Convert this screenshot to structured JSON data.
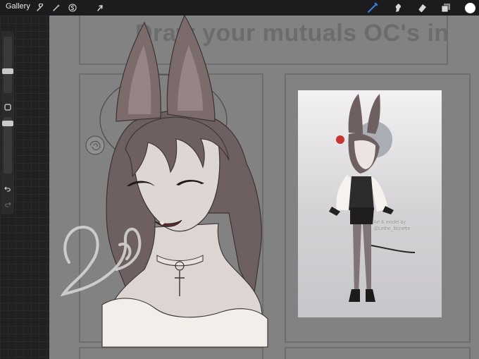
{
  "toolbar": {
    "gallery_label": "Gallery",
    "left_tools": [
      "wrench-icon",
      "magic-wand-icon",
      "selection-s-icon",
      "transform-arrow-icon"
    ],
    "right_tools": [
      "brush-icon",
      "smudge-icon",
      "eraser-icon",
      "layers-icon",
      "color-swatch"
    ],
    "active_tool": "brush-icon",
    "accent_color": "#3d7bd9",
    "current_color": "#ffffff"
  },
  "canvas": {
    "template_title": "Draw your mutuals OC's in",
    "reference_credit_line1": "Art & model by",
    "reference_credit_line2": "@Lethe_Bonette"
  }
}
